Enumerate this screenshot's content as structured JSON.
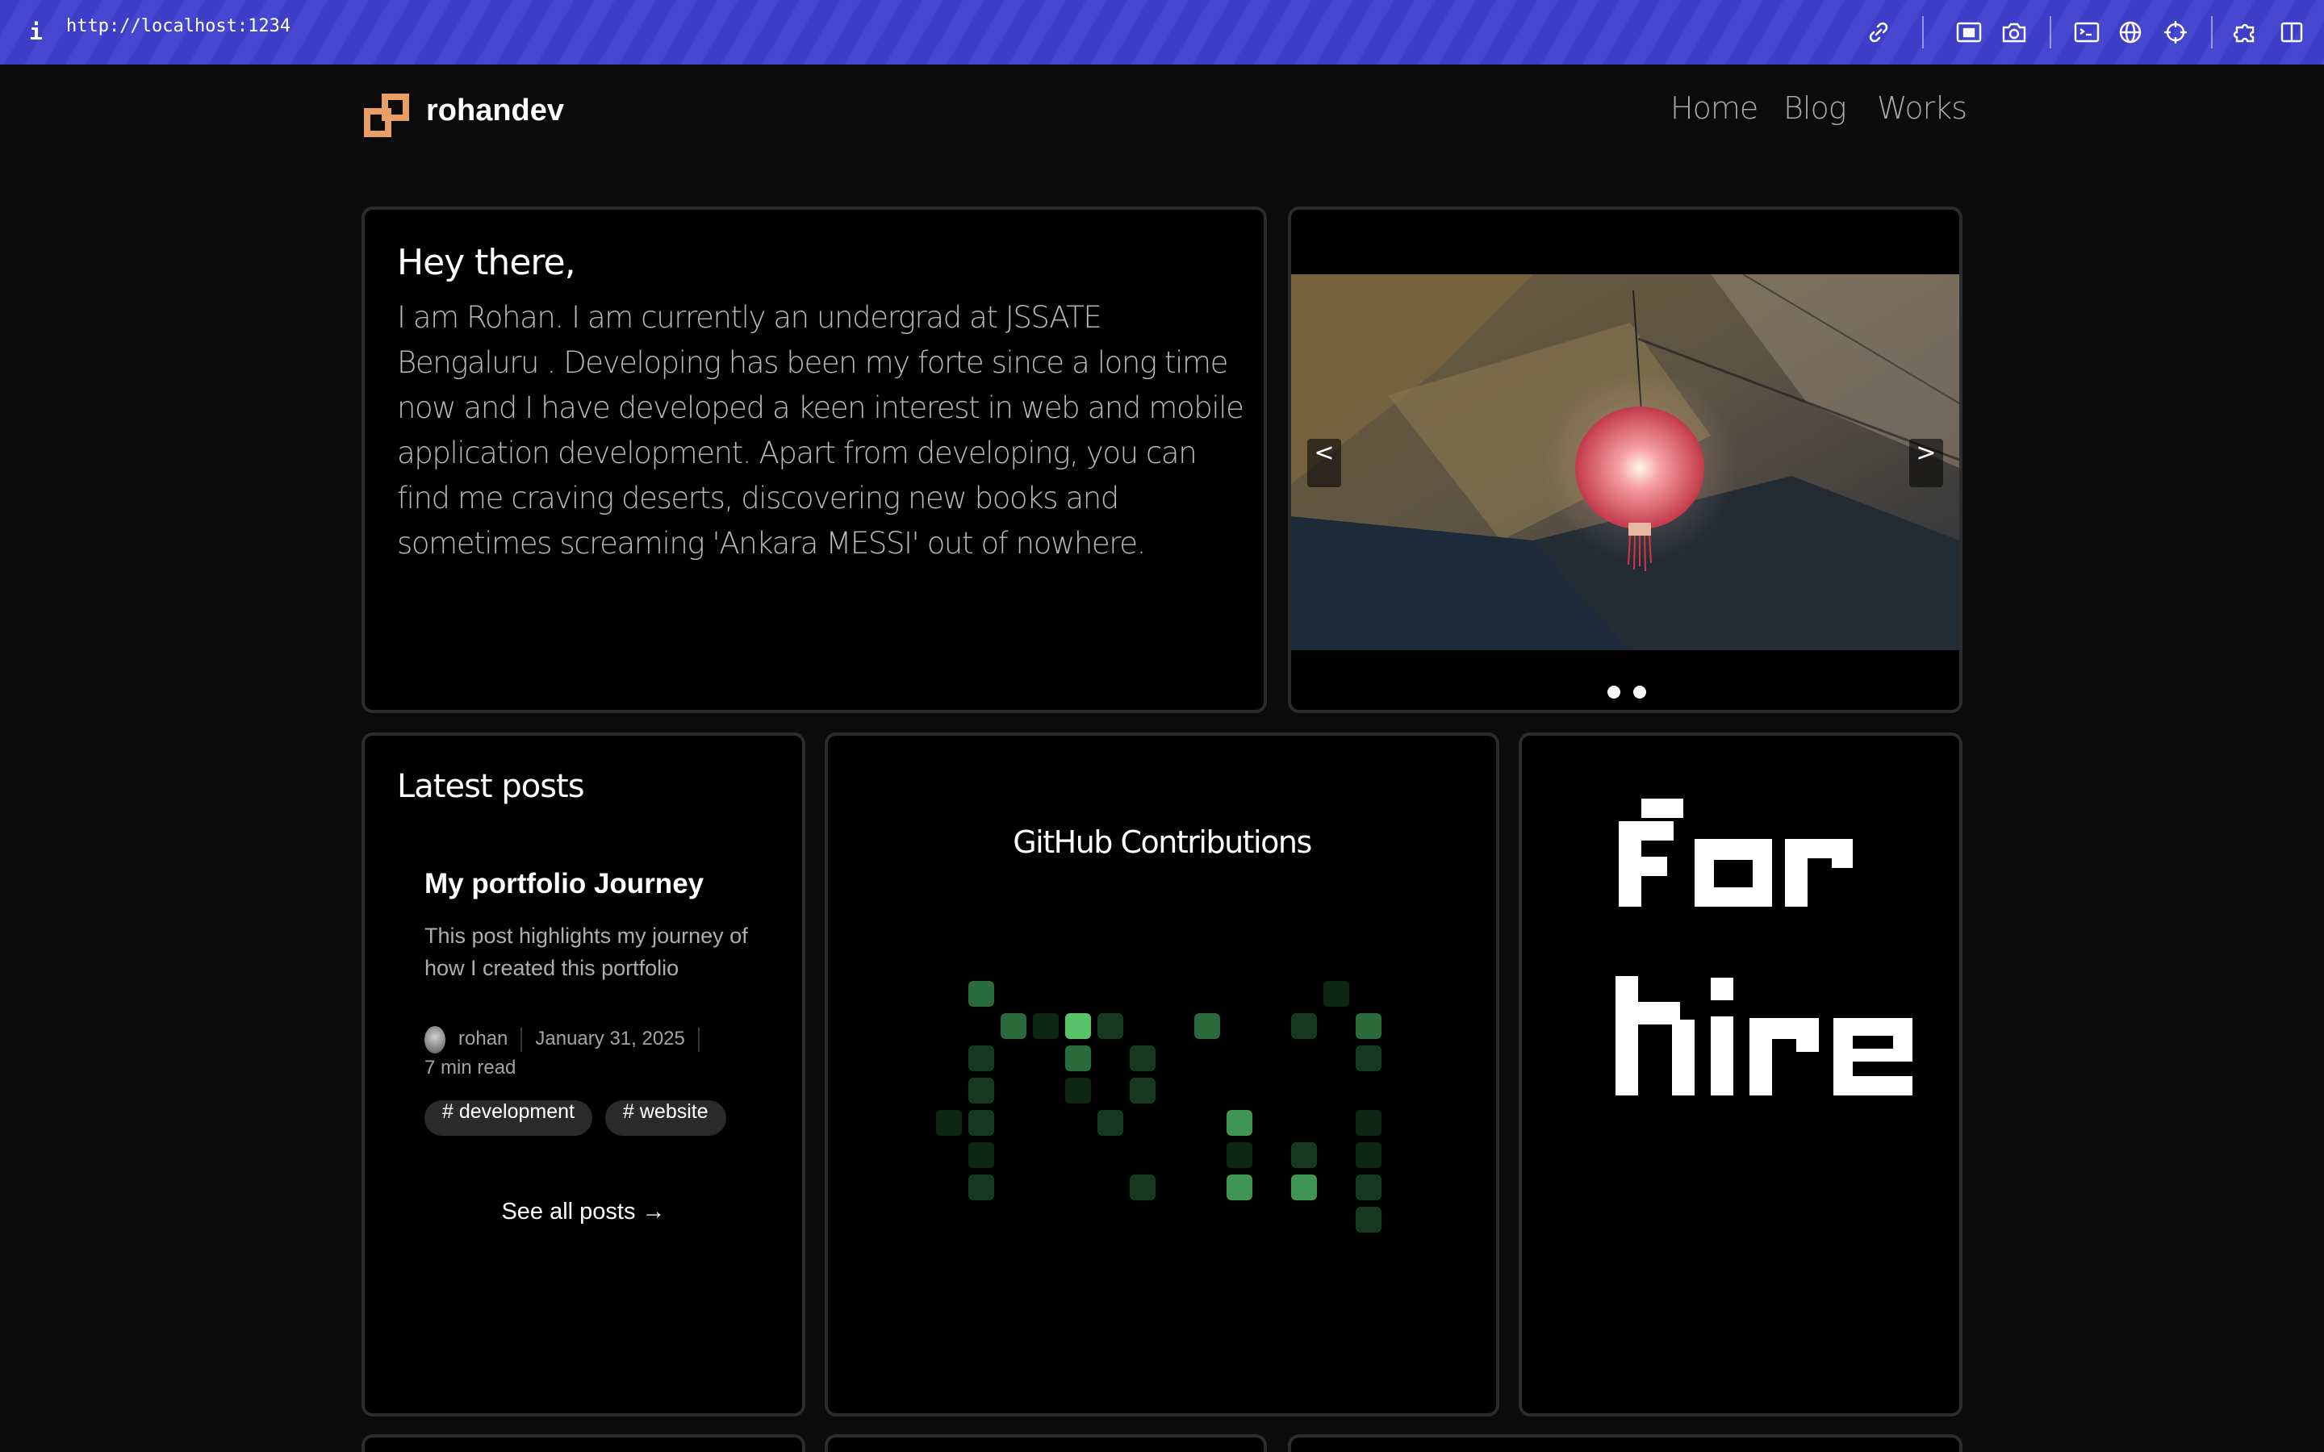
{
  "browser": {
    "url": "http://localhost:1234",
    "info_glyph": "i",
    "accent": "#4140cc",
    "toolbar_icons": [
      "link-icon",
      "picture-in-picture-icon",
      "camera-icon",
      "terminal-icon",
      "globe-icon",
      "crosshair-icon",
      "extensions-icon",
      "sidebar-toggle-icon"
    ]
  },
  "site": {
    "brand": "rohandev",
    "logo_color": "#e8a066",
    "nav": [
      "Home",
      "Blog",
      "Works"
    ]
  },
  "about": {
    "heading": "Hey there,",
    "body": "I am Rohan. I am currently an undergrad at JSSATE Bengaluru . Developing has been my forte since a long time now and I have developed a keen interest in web and mobile application development. Apart from developing, you can find me craving deserts, discovering new books and sometimes screaming 'Ankara MESSI' out of nowhere."
  },
  "carousel": {
    "prev_label": "<",
    "next_label": ">",
    "slide_count": 2,
    "active_index": 0
  },
  "posts": {
    "heading": "Latest posts",
    "items": [
      {
        "title": "My portfolio Journey",
        "description": "This post highlights my journey of how I created this portfolio",
        "author": "rohan",
        "date": "January 31, 2025",
        "read_time": "7 min read",
        "tags": [
          "# development",
          "# website"
        ]
      }
    ],
    "see_all": "See all posts →"
  },
  "github": {
    "title": "GitHub Contributions",
    "level_colors": [
      "#0e2614",
      "#163a1f",
      "#2b6a3a",
      "#3f9653",
      "#5ac26b"
    ]
  },
  "hire": {
    "text_line1": "for",
    "text_line2": "hire"
  }
}
